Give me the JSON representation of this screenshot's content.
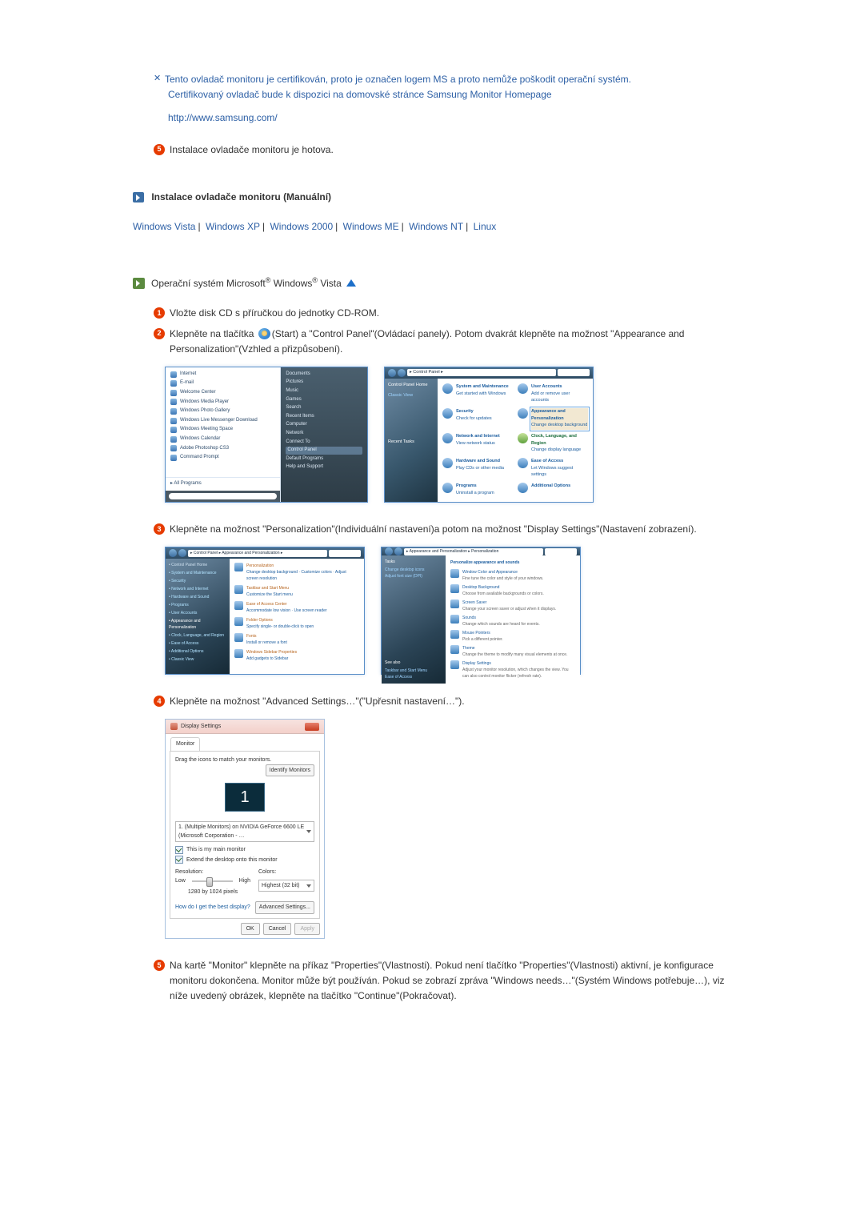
{
  "note": {
    "line1": "Tento ovladač monitoru je certifikován, proto je označen logem MS a proto nemůže poškodit operační systém.",
    "line2": "Certifikovaný ovladač bude k dispozici na domovské stránce Samsung Monitor Homepage",
    "url": "http://www.samsung.com/"
  },
  "step5_top": "Instalace ovladače monitoru je hotova.",
  "section_title": "Instalace ovladače monitoru (Manuální)",
  "oslinks": {
    "vista": "Windows Vista",
    "xp": "Windows XP",
    "w2000": "Windows 2000",
    "me": "Windows ME",
    "nt": "Windows NT",
    "linux": "Linux"
  },
  "os_header": "Operační systém Microsoft® Windows® Vista",
  "steps": {
    "s1": "Vložte disk CD s příručkou do jednotky CD-ROM.",
    "s2a": "Klepněte na tlačítka ",
    "s2b": "(Start) a \"Control Panel\"(Ovládací panely). Potom dvakrát klepněte na možnost \"Appearance and Personalization\"(Vzhled a přizpůsobení).",
    "s3": "Klepněte na možnost \"Personalization\"(Individuální nastavení)a potom na možnost \"Display Settings\"(Nastavení zobrazení).",
    "s4": "Klepněte na možnost \"Advanced Settings…\"(\"Upřesnit nastavení…\").",
    "s5": "Na kartě \"Monitor\" klepněte na příkaz \"Properties\"(Vlastnosti). Pokud není tlačítko \"Properties\"(Vlastnosti) aktivní, je konfigurace monitoru dokončena. Monitor může být používán. Pokud se zobrazí zpráva \"Windows needs…\"(Systém Windows potřebuje…), viz níže uvedený obrázek, klepněte na tlačítko \"Continue\"(Pokračovat)."
  },
  "startmenu": {
    "left": [
      "Internet",
      "E-mail",
      "Welcome Center",
      "Windows Media Player",
      "Windows Photo Gallery",
      "Windows Live Messenger Download",
      "Windows Meeting Space",
      "Windows Calendar",
      "Adobe Photoshop CS3",
      "Command Prompt"
    ],
    "allprograms": "All Programs",
    "right": [
      "Documents",
      "Pictures",
      "Music",
      "Games",
      "Search",
      "Recent Items",
      "Computer",
      "Network",
      "Connect To",
      "Control Panel",
      "Default Programs",
      "Help and Support"
    ],
    "right_hl": "Control Panel"
  },
  "cpanel": {
    "path": "▸ Control Panel ▸",
    "sidebar_t": "Control Panel Home",
    "sidebar_c": "Classic View",
    "sidebar_r": "Recent Tasks",
    "cats": [
      {
        "t": "System and Maintenance",
        "sub": "Get started with Windows",
        "cls": "blue"
      },
      {
        "t": "User Accounts",
        "sub": "Add or remove user accounts",
        "cls": "blue"
      },
      {
        "t": "Security",
        "sub": "Check for updates",
        "cls": "blue"
      },
      {
        "t": "Appearance and Personalization",
        "sub": "Change desktop background",
        "cls": "blue",
        "hl": true
      },
      {
        "t": "Network and Internet",
        "sub": "View network status",
        "cls": "blue"
      },
      {
        "t": "Clock, Language, and Region",
        "sub": "Change display language",
        "cls": "cl"
      },
      {
        "t": "Hardware and Sound",
        "sub": "Play CDs or other media",
        "cls": "blue"
      },
      {
        "t": "Ease of Access",
        "sub": "Let Windows suggest settings",
        "cls": "blue"
      },
      {
        "t": "Programs",
        "sub": "Uninstall a program",
        "cls": "blue"
      },
      {
        "t": "Additional Options",
        "sub": "",
        "cls": "blue"
      }
    ]
  },
  "appearance": {
    "path": "▸ Control Panel ▸ Appearance and Personalization ▸",
    "sidebar": [
      "Control Panel Home",
      "System and Maintenance",
      "Security",
      "Network and Internet",
      "Hardware and Sound",
      "Programs",
      "User Accounts",
      "Appearance and Personalization",
      "Clock, Language, and Region",
      "Ease of Access",
      "Additional Options",
      "Classic View"
    ],
    "main": [
      {
        "t": "Personalization",
        "sub": "Change desktop background · Customize colors · Adjust screen resolution"
      },
      {
        "t": "Taskbar and Start Menu",
        "sub": "Customize the Start menu"
      },
      {
        "t": "Ease of Access Center",
        "sub": "Accommodate low vision · Use screen reader"
      },
      {
        "t": "Folder Options",
        "sub": "Specify single- or double-click to open"
      },
      {
        "t": "Fonts",
        "sub": "Install or remove a font"
      },
      {
        "t": "Windows Sidebar Properties",
        "sub": "Add gadgets to Sidebar"
      }
    ]
  },
  "personalization": {
    "path": "▸ Appearance and Personalization ▸ Personalization",
    "sidebar_t": "Tasks",
    "sidebar": [
      "Change desktop icons",
      "Adjust font size (DPI)"
    ],
    "heading": "Personalize appearance and sounds",
    "items": [
      {
        "t": "Window Color and Appearance",
        "sub": "Fine tune the color and style of your windows."
      },
      {
        "t": "Desktop Background",
        "sub": "Choose from available backgrounds or colors."
      },
      {
        "t": "Screen Saver",
        "sub": "Change your screen saver or adjust when it displays."
      },
      {
        "t": "Sounds",
        "sub": "Change which sounds are heard for events."
      },
      {
        "t": "Mouse Pointers",
        "sub": "Pick a different pointer."
      },
      {
        "t": "Theme",
        "sub": "Change the theme to modify many visual elements at once."
      },
      {
        "t": "Display Settings",
        "sub": "Adjust your monitor resolution, which changes the view. You can also control monitor flicker (refresh rate)."
      }
    ],
    "seealso": "See also",
    "seealso_items": [
      "Taskbar and Start Menu",
      "Ease of Access"
    ]
  },
  "dispset": {
    "title": "Display Settings",
    "tab": "Monitor",
    "instr": "Drag the icons to match your monitors.",
    "identify": "Identify Monitors",
    "monnum": "1",
    "dropdown": "1. (Multiple Monitors) on NVIDIA GeForce 6600 LE (Microsoft Corporation - …",
    "chk1": "This is my main monitor",
    "chk2": "Extend the desktop onto this monitor",
    "res_lbl": "Resolution:",
    "col_lbl": "Colors:",
    "low": "Low",
    "high": "High",
    "col_dd": "Highest (32 bit)",
    "respx": "1280 by 1024 pixels",
    "help": "How do I get the best display?",
    "adv": "Advanced Settings...",
    "ok": "OK",
    "cancel": "Cancel",
    "apply": "Apply"
  }
}
